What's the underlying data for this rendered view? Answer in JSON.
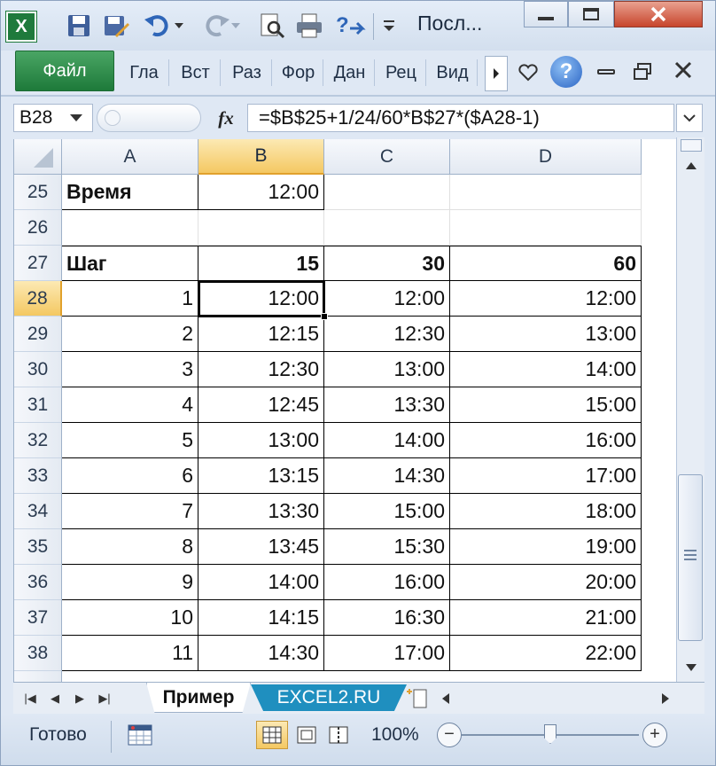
{
  "window": {
    "title": "Посл...",
    "logo_letter": "X"
  },
  "ribbon": {
    "file_tab": "Файл",
    "tabs": [
      "Гла",
      "Вст",
      "Раз",
      "Фор",
      "Дан",
      "Рец",
      "Вид"
    ]
  },
  "formula_bar": {
    "name_box": "B28",
    "fx_label": "fx",
    "formula": "=$B$25+1/24/60*B$27*($A28-1)"
  },
  "grid": {
    "columns": [
      "A",
      "B",
      "C",
      "D"
    ],
    "selected_column": "B",
    "selected_row": "28",
    "rows": [
      {
        "num": "25",
        "a": "Время",
        "b": "12:00",
        "c": "",
        "d": ""
      },
      {
        "num": "26",
        "a": "",
        "b": "",
        "c": "",
        "d": ""
      },
      {
        "num": "27",
        "a": "Шаг",
        "b": "15",
        "c": "30",
        "d": "60"
      },
      {
        "num": "28",
        "a": "1",
        "b": "12:00",
        "c": "12:00",
        "d": "12:00"
      },
      {
        "num": "29",
        "a": "2",
        "b": "12:15",
        "c": "12:30",
        "d": "13:00"
      },
      {
        "num": "30",
        "a": "3",
        "b": "12:30",
        "c": "13:00",
        "d": "14:00"
      },
      {
        "num": "31",
        "a": "4",
        "b": "12:45",
        "c": "13:30",
        "d": "15:00"
      },
      {
        "num": "32",
        "a": "5",
        "b": "13:00",
        "c": "14:00",
        "d": "16:00"
      },
      {
        "num": "33",
        "a": "6",
        "b": "13:15",
        "c": "14:30",
        "d": "17:00"
      },
      {
        "num": "34",
        "a": "7",
        "b": "13:30",
        "c": "15:00",
        "d": "18:00"
      },
      {
        "num": "35",
        "a": "8",
        "b": "13:45",
        "c": "15:30",
        "d": "19:00"
      },
      {
        "num": "36",
        "a": "9",
        "b": "14:00",
        "c": "16:00",
        "d": "20:00"
      },
      {
        "num": "37",
        "a": "10",
        "b": "14:15",
        "c": "16:30",
        "d": "21:00"
      },
      {
        "num": "38",
        "a": "11",
        "b": "14:30",
        "c": "17:00",
        "d": "22:00"
      }
    ]
  },
  "sheets": {
    "active": "Пример",
    "other": "EXCEL2.RU"
  },
  "status": {
    "ready": "Готово",
    "zoom": "100%",
    "zoom_level": 1.0
  },
  "colors": {
    "file_tab": "#1e7a3a",
    "selection_header": "#f4c862",
    "sheet_tab_accent": "#1f8fbf"
  }
}
